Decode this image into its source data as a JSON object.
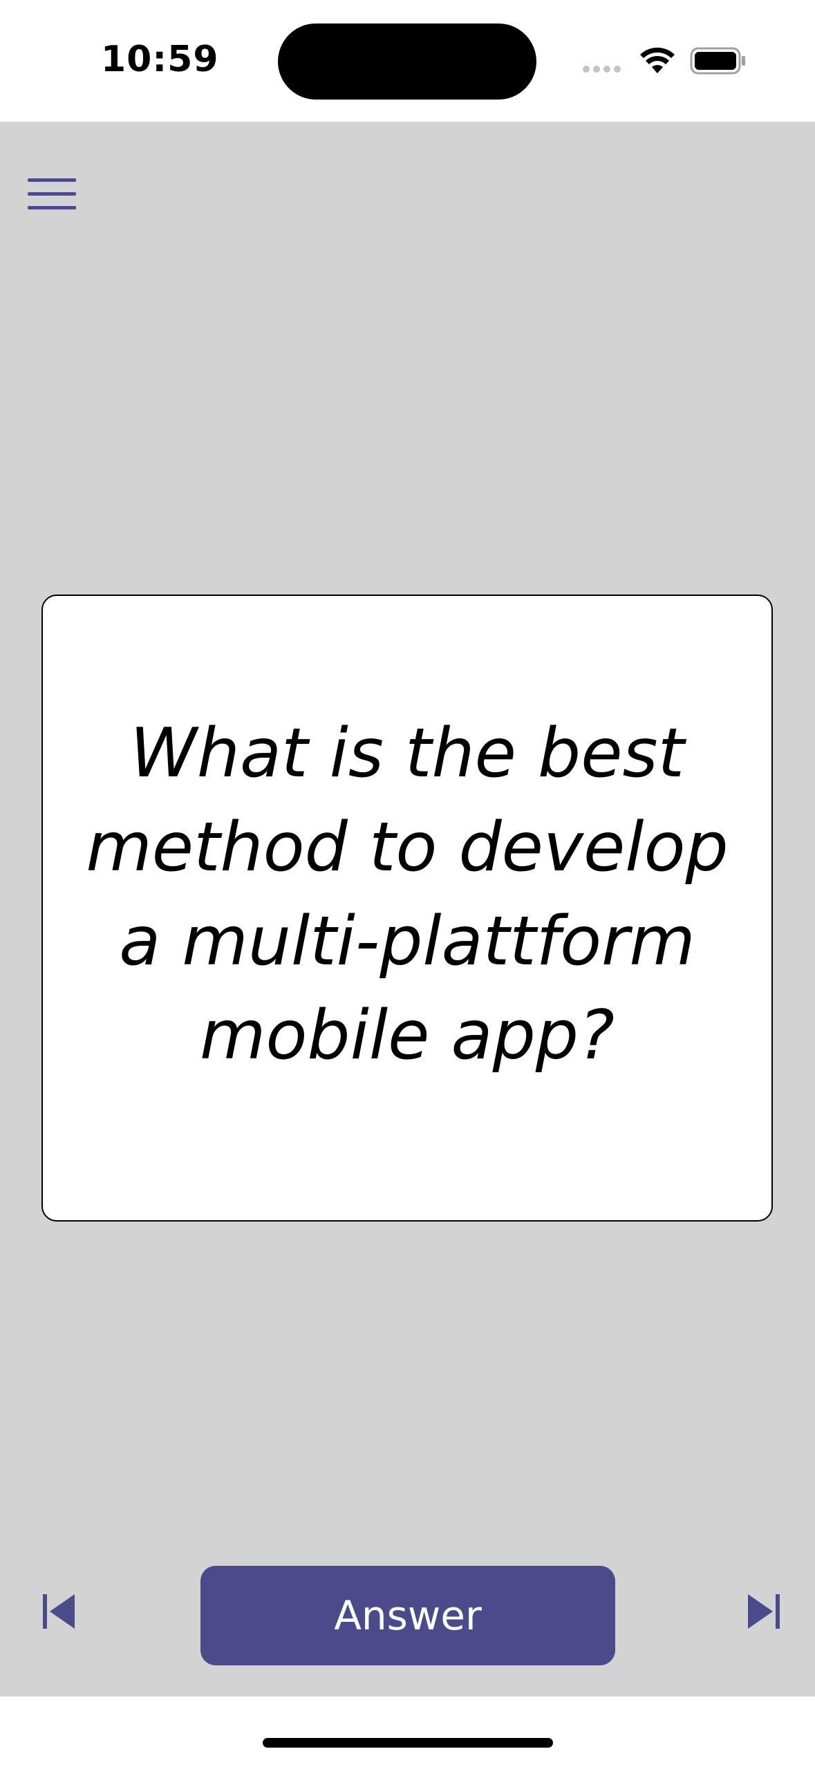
{
  "status_bar": {
    "time": "10:59"
  },
  "flashcard": {
    "question": "What is the best method to develop a multi-plattform mobile app?"
  },
  "controls": {
    "answer_label": "Answer"
  },
  "icons": {
    "menu": "hamburger-menu-icon",
    "previous": "skip-previous-icon",
    "next": "skip-next-icon",
    "wifi": "wifi-icon",
    "battery": "battery-icon"
  },
  "colors": {
    "accent": "#4b4a8a",
    "background": "#d3d3d4",
    "card": "#ffffff"
  }
}
